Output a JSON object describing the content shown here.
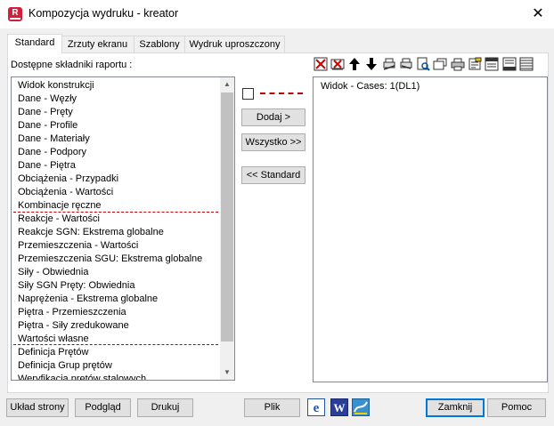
{
  "window": {
    "title": "Kompozycja wydruku - kreator",
    "app_icon_letter": "R",
    "close_glyph": "✕"
  },
  "tabs": [
    {
      "label": "Standard",
      "active": true
    },
    {
      "label": "Zrzuty ekranu",
      "active": false
    },
    {
      "label": "Szablony",
      "active": false
    },
    {
      "label": "Wydruk uproszczony",
      "active": false
    }
  ],
  "available": {
    "label": "Dostępne składniki raportu :",
    "items": [
      "Widok konstrukcji",
      "Dane - Węzły",
      "Dane - Pręty",
      "Dane - Profile",
      "Dane - Materiały",
      "Dane - Podpory",
      "Dane - Piętra",
      "Obciążenia - Przypadki",
      "Obciążenia - Wartości",
      "Kombinacje ręczne",
      "Reakcje - Wartości",
      "Reakcje SGN: Ekstrema globalne",
      "Przemieszczenia - Wartości",
      "Przemieszczenia SGU: Ekstrema globalne",
      "Siły - Obwiednia",
      "Siły SGN Pręty: Obwiednia",
      "Naprężenia - Ekstrema globalne",
      "Piętra - Przemieszczenia",
      "Piętra - Siły zredukowane",
      "Wartości własne",
      "Definicja Prętów",
      "Definicja Grup prętów",
      "Weryfikacja prętów stalowych"
    ]
  },
  "middle": {
    "add_label": "Dodaj >",
    "all_label": "Wszystko >>",
    "standard_label": "<< Standard"
  },
  "report": {
    "items": [
      "Widok - Cases: 1(DL1)"
    ]
  },
  "toolbar_icons": [
    "delete-icon",
    "delete-all-icon",
    "move-up-icon",
    "move-down-icon",
    "print-settings-icon",
    "print-settings-2-icon",
    "preview-icon",
    "open-icon",
    "print-icon",
    "edit-icon",
    "layout-icon",
    "layout-2-icon",
    "table-icon"
  ],
  "bottom": {
    "page_layout_label": "Układ strony",
    "preview_label": "Podgląd",
    "print_label": "Drukuj",
    "file_label": "Plik",
    "close_label": "Zamknij",
    "help_label": "Pomoc"
  },
  "colors": {
    "separator": "#c00000",
    "app_icon": "#d1203a",
    "default_button_border": "#0078d7"
  }
}
